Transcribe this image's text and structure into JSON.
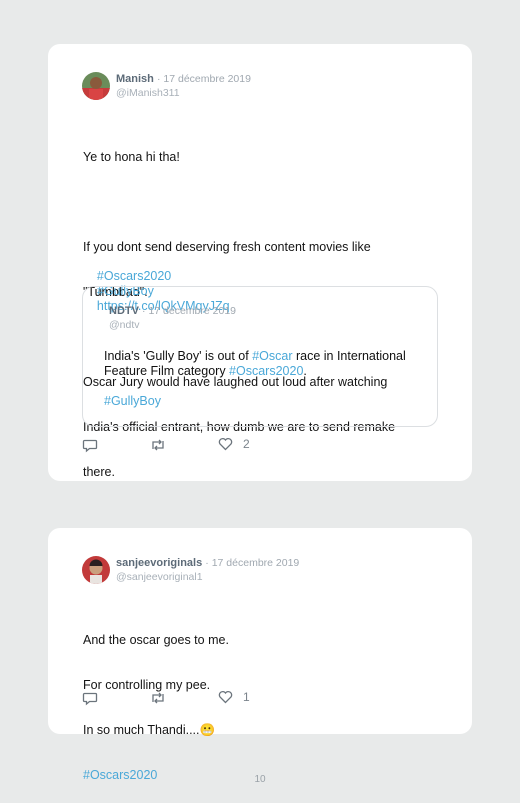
{
  "tweets": [
    {
      "name": "Manish",
      "date": "17 décembre 2019",
      "handle": "@iManish311",
      "text_lines": [
        "Ye to hona hi tha!",
        "",
        "If you dont send deserving fresh content movies like",
        "\"Tumbbad\".",
        "",
        "Oscar Jury would have laughed out loud after watching",
        "India's official entrant, how dumb we are to send remake",
        "there."
      ],
      "links": [
        "#Oscars2020",
        "#GullyBoy",
        "https://t.co/lQkVMqyJZq"
      ],
      "quote": {
        "name": "NDTV",
        "date": "17 décembre 2019",
        "handle": "@ndtv",
        "text_before": "India's 'Gully Boy' is out of ",
        "tag1": "#Oscar",
        "text_mid": " race in International Feature Film category ",
        "tag2": "#Oscars2020",
        "text_end": ".",
        "tag3": "#GullyBoy"
      },
      "like_count": "2"
    },
    {
      "name": "sanjeevoriginals",
      "date": "17 décembre 2019",
      "handle": "@sanjeevoriginal1",
      "text_lines": [
        "And the oscar goes to me.",
        "For controlling my pee.",
        "In so much Thandi....😬"
      ],
      "links": [
        "#Oscars2020"
      ],
      "like_count": "1"
    }
  ],
  "page_number": "10",
  "colors": {
    "link": "#4aa8d8",
    "background": "#e8eaea",
    "card": "#ffffff"
  },
  "icons": [
    "reply-icon",
    "retweet-icon",
    "heart-icon"
  ]
}
